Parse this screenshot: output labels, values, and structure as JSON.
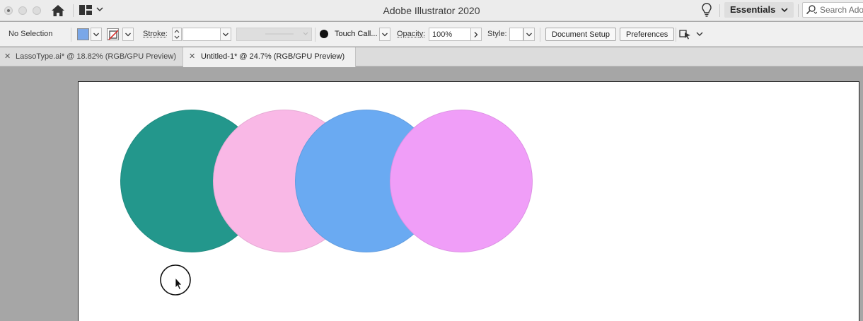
{
  "titlebar": {
    "app_title": "Adobe Illustrator 2020",
    "workspace": "Essentials",
    "search_placeholder": "Search Adobe"
  },
  "controlbar": {
    "selection_status": "No Selection",
    "fill_color": "#7aa7e8",
    "stroke_label": "Stroke:",
    "stroke_value": "",
    "brush_name": "Touch Call...",
    "opacity_label": "Opacity:",
    "opacity_value": "100%",
    "style_label": "Style:",
    "document_setup_label": "Document Setup",
    "preferences_label": "Preferences"
  },
  "tabs": [
    {
      "label": "LassoType.ai* @ 18.82% (RGB/GPU Preview)",
      "active": false
    },
    {
      "label": "Untitled-1* @ 24.7% (RGB/GPU Preview)",
      "active": true
    }
  ],
  "artboard": {
    "circles": [
      {
        "color": "#23978c"
      },
      {
        "color": "#f9b8e6"
      },
      {
        "color": "#6aaaf2"
      },
      {
        "color": "#f09ef8"
      }
    ]
  }
}
